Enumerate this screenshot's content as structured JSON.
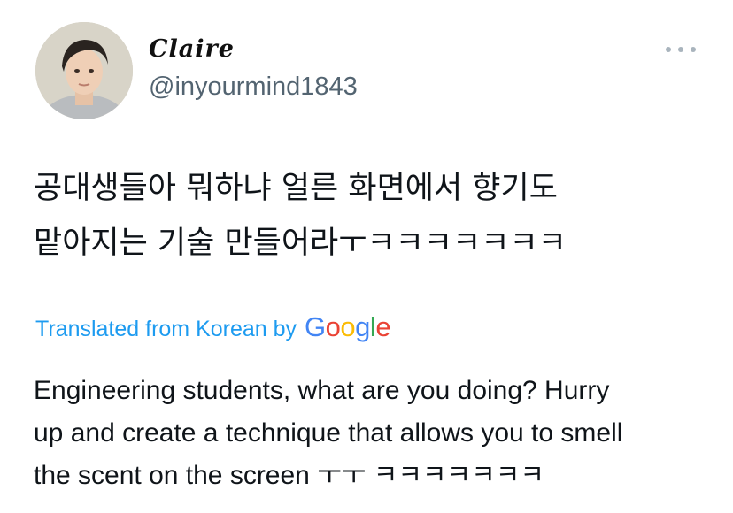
{
  "tweet": {
    "author": {
      "display_name": "Claire",
      "handle": "@inyourmind1843"
    },
    "more_icon": "more-horizontal-icon",
    "original_text_lines": [
      "공대생들아 뭐하냐 얼른 화면에서 향기도",
      "맡아지는 기술 만들어라ㅜㅋㅋㅋㅋㅋㅋㅋ"
    ],
    "translation": {
      "label": "Translated from Korean by",
      "provider": "Google",
      "provider_letters": [
        "G",
        "o",
        "o",
        "g",
        "l",
        "e"
      ],
      "provider_colors": [
        "#4285F4",
        "#EA4335",
        "#FBBC05",
        "#4285F4",
        "#34A853",
        "#EA4335"
      ],
      "text_lines": [
        "Engineering students, what are you doing? Hurry",
        "up and create a technique that allows you to smell",
        "the scent on the screen ㅜㅜ ㅋㅋㅋㅋㅋㅋㅋ"
      ]
    },
    "colors": {
      "link": "#1d9bf0",
      "handle": "#536471",
      "text": "#0f1419"
    }
  }
}
